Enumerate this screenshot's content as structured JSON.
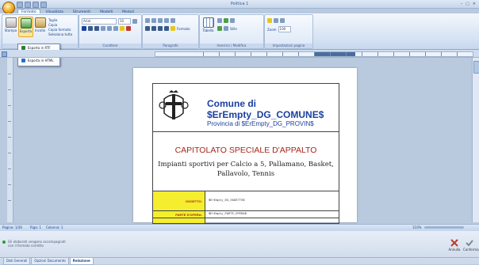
{
  "window": {
    "title": "Politica 1",
    "controls": [
      "–",
      "▢",
      "✕"
    ]
  },
  "tabs": [
    {
      "label": "Formato",
      "active": true
    },
    {
      "label": "Visualizza",
      "active": false
    },
    {
      "label": "Strumenti",
      "active": false
    },
    {
      "label": "Modelli",
      "active": false
    },
    {
      "label": "Moduli",
      "active": false
    }
  ],
  "ribbon": {
    "stampa_label": "Stampa",
    "esporta_label": "Esporta",
    "incolla_label": "Incolla",
    "clipboard": {
      "taglia": "Taglia",
      "copia": "Copia",
      "copia_formato": "Copia formato",
      "seleziona_tutto": "Seleziona tutto"
    },
    "font_name": "Arial",
    "font_size": "10",
    "formato_label": "Formato",
    "tabella_label": "Tabella",
    "stile_label": "Stile",
    "zoom_label": "Zoom",
    "zoom_value": "100",
    "groups": {
      "appunti": "Appunti",
      "carattere": "Carattere",
      "paragrafo": "Paragrafo",
      "inserisci": "Inserisci / Modifica",
      "impostazioni": "Impostazioni pagina"
    }
  },
  "export_menu": {
    "items": [
      {
        "label": "Esporta in RTF",
        "color": "#2f7d2f"
      },
      {
        "label": "Esporta in PDF",
        "color": "#c0392b"
      },
      {
        "label": "Esporta in HTML",
        "color": "#2e6fbd"
      }
    ]
  },
  "document": {
    "comune_line1": "Comune di",
    "comune_line2": "$ErEmpty_DG_COMUNE$",
    "provincia": "Provincia di $ErEmpty_DG_PROVIN$",
    "title": "CAPITOLATO SPECIALE D'APPALTO",
    "subtitle_line1": "Impianti sportivi per Calcio a 5, Pallamano, Basket,",
    "subtitle_line2": "Pallavolo, Tennis",
    "rows": [
      {
        "label": "OGGETTO:",
        "value": "$ErEmpty_DG_OGGETTO$"
      },
      {
        "label": "PARTE D'OPERA:",
        "value": "$ErEmpty_PARTE_OPERA$"
      }
    ]
  },
  "statusbar": {
    "pagina": "Pagina: 1/26",
    "riga": "Riga: 1",
    "colonna": "Colonna: 1",
    "zoom": "110%"
  },
  "bottom": {
    "message_line1": "Gli elaborati vengono accompagnati",
    "message_line2": "con il formato corretto",
    "annulla": "Annulla",
    "conferma": "Conferma",
    "tabs": [
      {
        "label": "Dati Generali",
        "active": false
      },
      {
        "label": "Opzioni Documento",
        "active": false
      },
      {
        "label": "Relazione",
        "active": true
      }
    ]
  },
  "colors": {
    "accent": "#1b3fa0",
    "title_red": "#a8261b",
    "label_yellow": "#f4ee2e"
  }
}
